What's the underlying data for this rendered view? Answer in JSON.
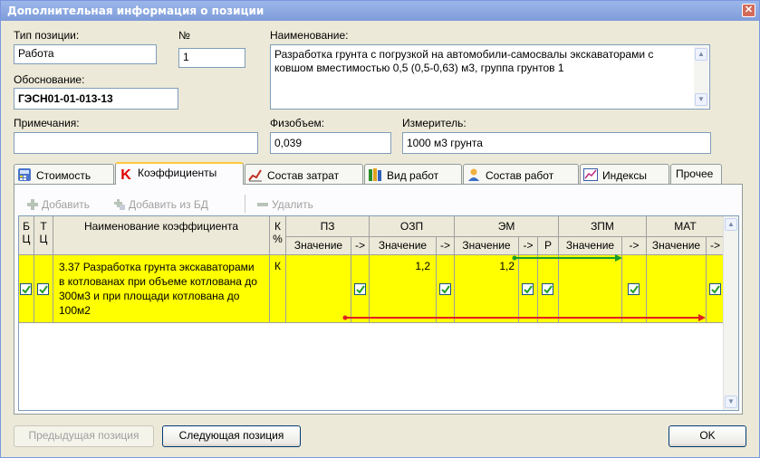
{
  "window": {
    "title": "Дополнительная информация о позиции",
    "close_glyph": "✕"
  },
  "fields": {
    "type_label": "Тип позиции:",
    "type_value": "Работа",
    "number_label": "№",
    "number_value": "1",
    "name_label": "Наименование:",
    "name_value": "Разработка грунта с погрузкой на автомобили-самосвалы экскаваторами с ковшом вместимостью 0,5 (0,5-0,63) м3, группа грунтов 1",
    "basis_label": "Обоснование:",
    "basis_value": "ГЭСН01-01-013-13",
    "notes_label": "Примечания:",
    "notes_value": "",
    "volume_label": "Физобъем:",
    "volume_value": "0,039",
    "unit_label": "Измеритель:",
    "unit_value": "1000 м3 грунта"
  },
  "tabs": [
    {
      "label": "Стоимость",
      "icon": "calculator-icon",
      "active": false
    },
    {
      "label": "Коэффициенты",
      "icon": "k-letter-icon",
      "active": true
    },
    {
      "label": "Состав затрат",
      "icon": "chart-pen-icon",
      "active": false
    },
    {
      "label": "Вид работ",
      "icon": "books-icon",
      "active": false
    },
    {
      "label": "Состав работ",
      "icon": "person-icon",
      "active": false
    },
    {
      "label": "Индексы",
      "icon": "graph-icon",
      "active": false
    },
    {
      "label": "Прочее",
      "icon": "",
      "active": false
    }
  ],
  "toolbar": {
    "add": "Добавить",
    "add_from_db": "Добавить из БД",
    "delete": "Удалить"
  },
  "grid": {
    "headers": {
      "b": "Б\nЦ",
      "t": "Т\nЦ",
      "name": "Наименование коэффициента",
      "k": "К\n%",
      "pz": "ПЗ",
      "ozp": "ОЗП",
      "em": "ЭМ",
      "zpm": "ЗПМ",
      "mat": "МАТ",
      "value": "Значение",
      "arrow": "->",
      "r": "Р"
    },
    "rows": [
      {
        "b_checked": true,
        "t_checked": true,
        "name": "3.37 Разработка грунта экскаваторами в котлованах при объеме котлована до 300м3 и при площади котлована до 100м2",
        "k": "К",
        "pz_value": "",
        "pz_arrow": true,
        "ozp_value": "1,2",
        "ozp_arrow": true,
        "em_value": "1,2",
        "em_arrow": true,
        "em_r": true,
        "zpm_value": "",
        "zpm_arrow": true,
        "mat_value": "",
        "mat_arrow": true
      }
    ]
  },
  "buttons": {
    "prev": "Предыдущая позиция",
    "next": "Следующая позиция",
    "ok": "OK"
  },
  "annotations": {
    "green_arrow_color": "#1a9a2a",
    "red_arrow_color": "#e02020"
  }
}
